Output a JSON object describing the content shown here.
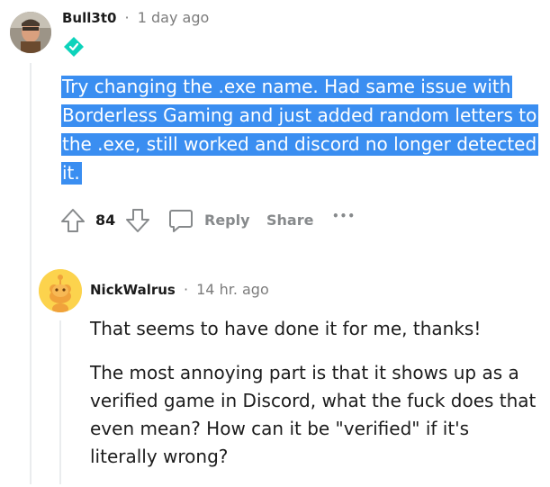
{
  "comment": {
    "author": "Bull3t0",
    "separator": "·",
    "time": "1 day ago",
    "body": "Try changing the .exe name. Had same issue with Borderless Gaming and just added random letters to the .exe, still worked and discord no longer detected it.",
    "votes": "84",
    "reply_label": "Reply",
    "share_label": "Share",
    "more_label": "•••"
  },
  "reply": {
    "author": "NickWalrus",
    "separator": "·",
    "time": "14 hr. ago",
    "paragraphs": [
      "That seems to have done it for me, thanks!",
      "The most annoying part is that it shows up as a verified game in Discord, what the fuck does that even mean? How can it be \"verified\" if it's literally wrong?"
    ]
  },
  "colors": {
    "highlight": "#3a8ef1",
    "flair_diamond": "#0dd3bb",
    "snoo_avatar_bg": "#fcd34d"
  },
  "icons": [
    "upvote-icon",
    "downvote-icon",
    "comment-bubble-icon",
    "flair-diamond-icon",
    "snoo-avatar-icon"
  ]
}
